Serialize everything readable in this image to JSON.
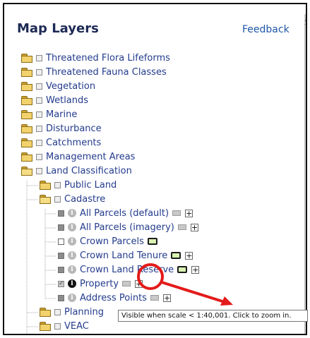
{
  "panel": {
    "title": "Map Layers",
    "feedback_label": "Feedback"
  },
  "layers": [
    {
      "label": "Threatened Flora Lifeforms",
      "level": 0,
      "type": "folder"
    },
    {
      "label": "Threatened Fauna Classes",
      "level": 0,
      "type": "folder"
    },
    {
      "label": "Vegetation",
      "level": 0,
      "type": "folder"
    },
    {
      "label": "Wetlands",
      "level": 0,
      "type": "folder"
    },
    {
      "label": "Marine",
      "level": 0,
      "type": "folder"
    },
    {
      "label": "Disturbance",
      "level": 0,
      "type": "folder"
    },
    {
      "label": "Catchments",
      "level": 0,
      "type": "folder"
    },
    {
      "label": "Management Areas",
      "level": 0,
      "type": "folder"
    },
    {
      "label": "Land Classification",
      "level": 0,
      "type": "folder-open"
    },
    {
      "label": "Public Land",
      "level": 1,
      "type": "folder"
    },
    {
      "label": "Cadastre",
      "level": 1,
      "type": "folder-open"
    },
    {
      "label": "All Parcels (default)",
      "level": 2,
      "type": "layer",
      "icon": "legend"
    },
    {
      "label": "All Parcels (imagery)",
      "level": 2,
      "type": "layer",
      "icon": "legend"
    },
    {
      "label": "Crown Parcels",
      "level": 2,
      "type": "layer",
      "icon": "tag"
    },
    {
      "label": "Crown Land Tenure",
      "level": 2,
      "type": "layer",
      "icon": "tag"
    },
    {
      "label": "Crown Land Reserve",
      "level": 2,
      "type": "layer",
      "icon": "tag"
    },
    {
      "label": "Property",
      "level": 2,
      "type": "layer",
      "icon": "legend",
      "checked": true
    },
    {
      "label": "Address Points",
      "level": 2,
      "type": "layer",
      "icon": "legend"
    },
    {
      "label": "Planning",
      "level": 1,
      "type": "folder"
    },
    {
      "label": "VEAC",
      "level": 1,
      "type": "folder"
    }
  ],
  "tooltip": {
    "text": "Visible when scale < 1:40,001. Click to zoom in."
  },
  "colors": {
    "accent": "#e31b1b",
    "link": "#233b8c",
    "title": "#1d2a55"
  }
}
